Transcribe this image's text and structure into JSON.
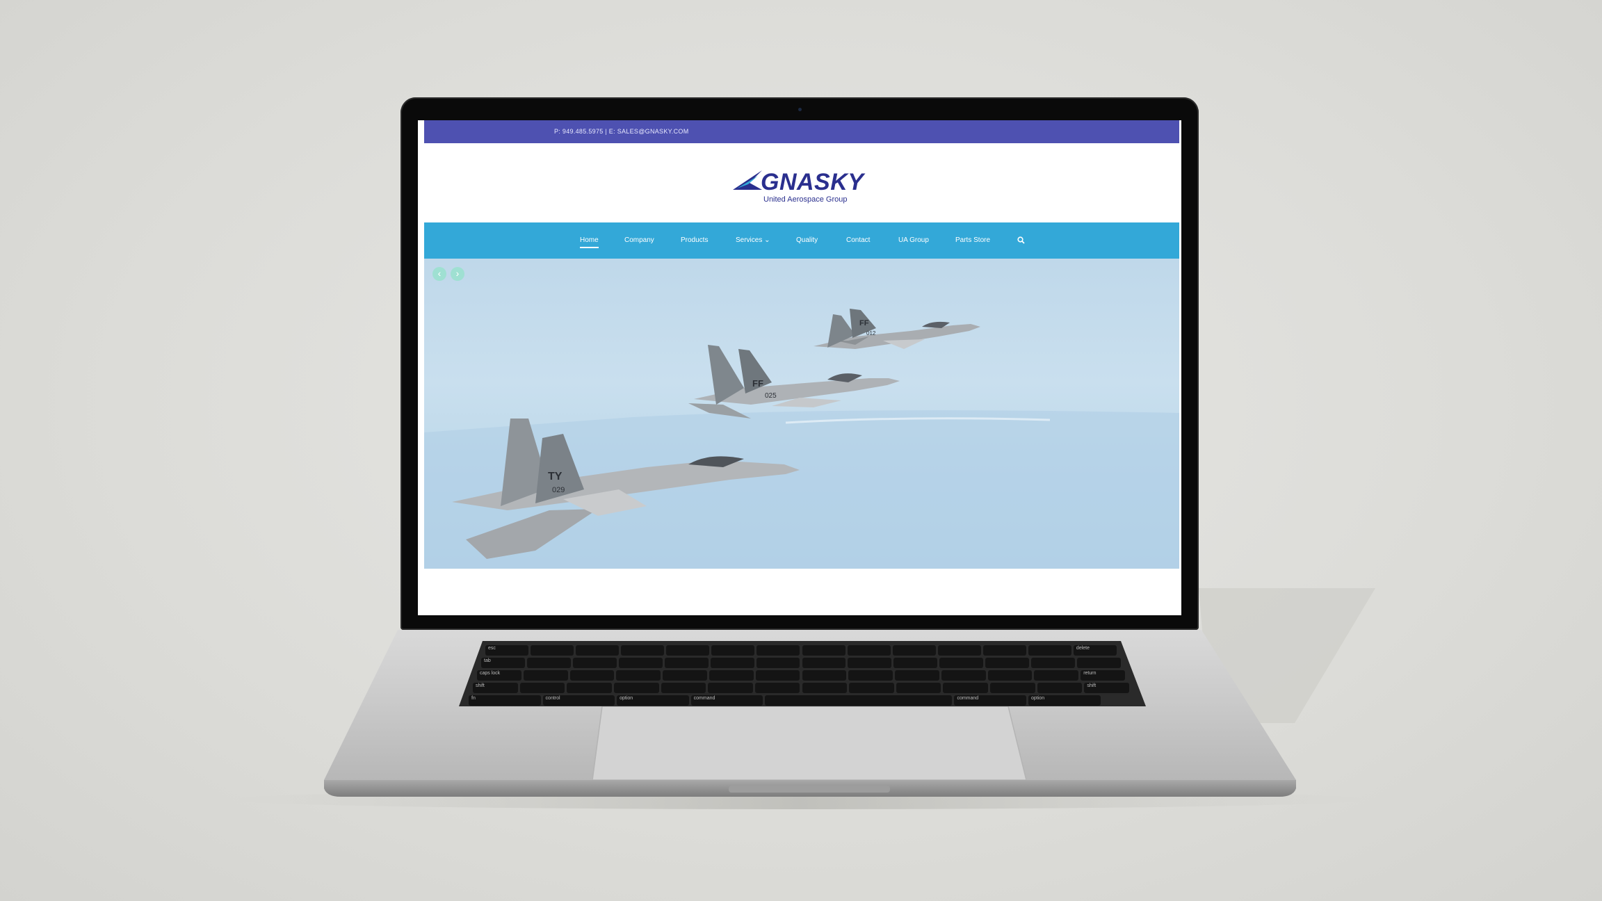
{
  "topbar": {
    "contact": "P: 949.485.5975 | E: SALES@GNASKY.COM"
  },
  "brand": {
    "name": "GNASKY",
    "tagline": "United Aerospace Group"
  },
  "nav": {
    "items": [
      {
        "label": "Home",
        "active": true
      },
      {
        "label": "Company"
      },
      {
        "label": "Products"
      },
      {
        "label": "Services ⌄"
      },
      {
        "label": "Quality"
      },
      {
        "label": "Contact"
      },
      {
        "label": "UA Group"
      },
      {
        "label": "Parts Store"
      }
    ],
    "search_icon": "search-icon"
  },
  "hero": {
    "prev_label": "‹",
    "next_label": "›",
    "tail_markings": {
      "rear_jet": {
        "code": "FF",
        "number": "012"
      },
      "middle_jet": {
        "code": "FF",
        "number": "025"
      },
      "front_jet": {
        "code": "TY",
        "number": "029"
      }
    }
  },
  "keyboard": {
    "labels": [
      "esc",
      "tab",
      "caps lock",
      "shift",
      "control",
      "option",
      "command",
      "command",
      "option",
      "shift",
      "return",
      "delete",
      "fn"
    ]
  },
  "colors": {
    "topbar": "#4e51b1",
    "nav": "#33a8d8",
    "brand": "#2a2f8e",
    "slider_arrow": "#9fe0d2"
  }
}
